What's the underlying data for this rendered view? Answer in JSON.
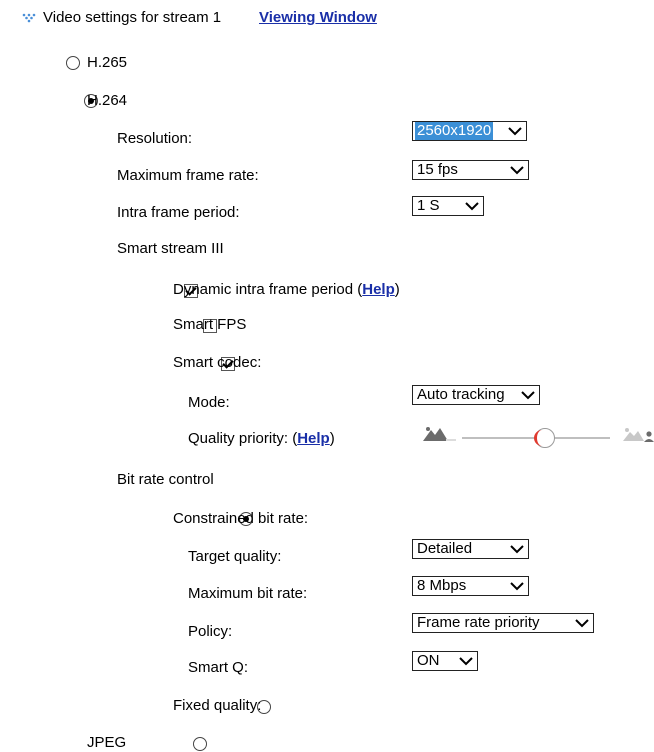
{
  "header": {
    "title": "Video settings for stream 1",
    "viewing_window_link": "Viewing Window"
  },
  "codecs": {
    "h265": "H.265",
    "h264": "H.264",
    "jpeg": "JPEG",
    "selected": "H.264"
  },
  "h264": {
    "resolution_label": "Resolution:",
    "resolution_value": "2560x1920",
    "max_frame_rate_label": "Maximum frame rate:",
    "max_frame_rate_value": "15 fps",
    "intra_frame_label": "Intra frame period:",
    "intra_frame_value": "1 S",
    "smart_stream_title": "Smart stream III",
    "dynamic_intra_label_prefix": "Dynamic intra frame period (",
    "dynamic_intra_help": "Help",
    "dynamic_intra_label_suffix": ")",
    "dynamic_intra_checked": true,
    "smart_fps_label": "Smart FPS",
    "smart_fps_checked": false,
    "smart_codec_label": "Smart codec:",
    "smart_codec_checked": true,
    "mode_label": "Mode:",
    "mode_value": "Auto tracking",
    "quality_priority_prefix": "Quality priority: (",
    "quality_priority_help": "Help",
    "quality_priority_suffix": ")",
    "quality_priority_level": 0.45,
    "bit_rate_control_title": "Bit rate control",
    "constrained_label": "Constrained bit rate:",
    "constrained_selected": true,
    "target_quality_label": "Target quality:",
    "target_quality_value": "Detailed",
    "max_bit_rate_label": "Maximum bit rate:",
    "max_bit_rate_value": "8 Mbps",
    "policy_label": "Policy:",
    "policy_value": "Frame rate priority",
    "smart_q_label": "Smart Q:",
    "smart_q_value": "ON",
    "fixed_quality_label": "Fixed quality:",
    "fixed_quality_selected": false
  },
  "icons": {
    "header": "stream-expand-icon",
    "select_arrow": "chevron-down-icon",
    "quality_low": "landscape-low-quality-icon",
    "quality_high": "landscape-person-icon"
  },
  "colors": {
    "link": "#1a2fa8",
    "selection": "#3b8fd6",
    "slider_accent": "#e03a2f",
    "header_icon": "#4a8fd8"
  }
}
